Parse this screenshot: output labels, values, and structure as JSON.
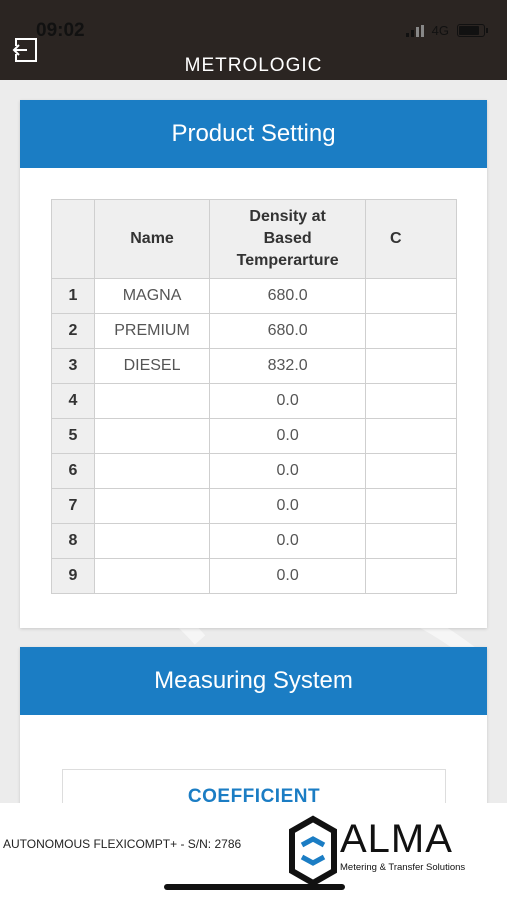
{
  "status": {
    "time": "09:02",
    "network": "4G"
  },
  "header": {
    "title": "METROLOGIC",
    "back_icon": "logout-icon"
  },
  "product_setting": {
    "title": "Product Setting",
    "columns": [
      "",
      "Name",
      "Density at Based Temperarture",
      "C"
    ],
    "rows": [
      [
        "1",
        "MAGNA",
        "680.0"
      ],
      [
        "2",
        "PREMIUM",
        "680.0"
      ],
      [
        "3",
        "DIESEL",
        "832.0"
      ],
      [
        "4",
        "",
        "0.0"
      ],
      [
        "5",
        "",
        "0.0"
      ],
      [
        "6",
        "",
        "0.0"
      ],
      [
        "7",
        "",
        "0.0"
      ],
      [
        "8",
        "",
        "0.0"
      ],
      [
        "9",
        "",
        "0.0"
      ]
    ]
  },
  "measuring_system": {
    "title": "Measuring System",
    "coefficient_label": "COEFFICIENT"
  },
  "footer": {
    "device": "AUTONOMOUS FLEXICOMPT+ - S/N: 2786",
    "logo_word": "ALMA",
    "logo_tagline": "Metering & Transfer Solutions"
  },
  "colors": {
    "accent": "#1b7dc4",
    "header_bg": "#2b2522"
  }
}
